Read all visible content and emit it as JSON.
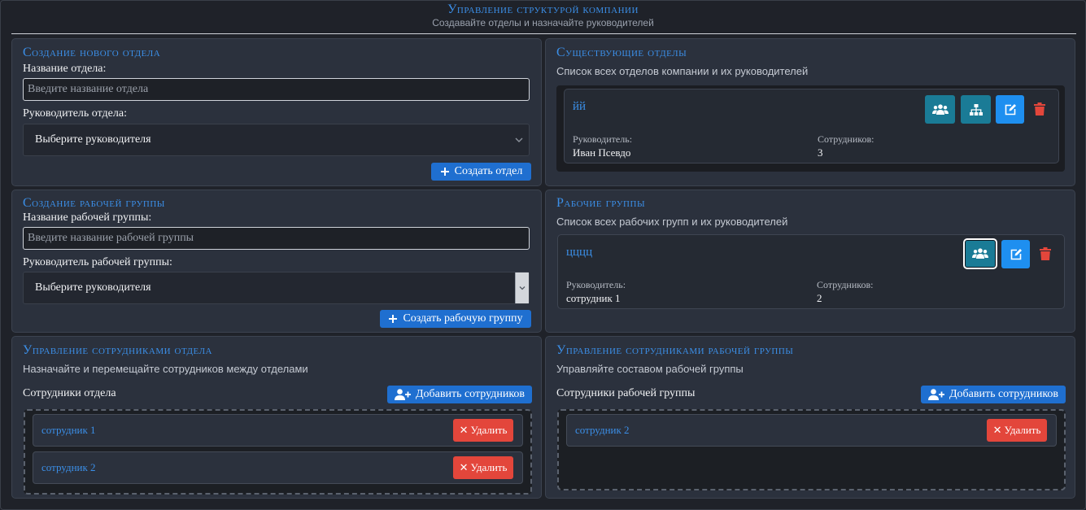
{
  "header": {
    "title": "Управление структурой компании",
    "subtitle": "Создавайте отделы и назначайте руководителей"
  },
  "create_department": {
    "title": "Создание нового отдела",
    "name_label": "Название отдела:",
    "name_placeholder": "Введите название отдела",
    "head_label": "Руководитель отдела:",
    "head_selected": "Выберите руководителя",
    "submit_label": "Создать отдел"
  },
  "create_workgroup": {
    "title": "Создание рабочей группы",
    "name_label": "Название рабочей группы:",
    "name_placeholder": "Введите название рабочей группы",
    "head_label": "Руководитель рабочей группы:",
    "head_selected": "Выберите руководителя",
    "submit_label": "Создать рабочую группу"
  },
  "departments": {
    "title": "Существующие отделы",
    "subtitle": "Список всех отделов компании и их руководителей",
    "items": [
      {
        "name": "йй",
        "head_label": "Руководитель:",
        "head_value": "Иван Псевдо",
        "count_label": "Сотрудников:",
        "count_value": "3"
      }
    ]
  },
  "workgroups": {
    "title": "Рабочие группы",
    "subtitle": "Список всех рабочих групп и их руководителей",
    "items": [
      {
        "name": "цццц",
        "head_label": "Руководитель:",
        "head_value": "сотрудник 1",
        "count_label": "Сотрудников:",
        "count_value": "2"
      }
    ]
  },
  "dept_staff": {
    "title": "Управление сотрудниками отдела",
    "subtitle": "Назначайте и перемещайте сотрудников между отделами",
    "list_label": "Сотрудники отдела",
    "add_label": "Добавить сотрудников",
    "employees": [
      {
        "name": "сотрудник 1",
        "remove_label": "Удалить"
      },
      {
        "name": "сотрудник 2",
        "remove_label": "Удалить"
      }
    ]
  },
  "group_staff": {
    "title": "Управление сотрудниками рабочей группы",
    "subtitle": "Управляйте составом рабочей группы",
    "list_label": "Сотрудники рабочей группы",
    "add_label": "Добавить сотрудников",
    "employees": [
      {
        "name": "сотрудник 2",
        "remove_label": "Удалить"
      }
    ]
  },
  "icons": {
    "users": "users-icon",
    "hierarchy": "sitemap-icon",
    "edit": "edit-icon",
    "delete": "trash-icon",
    "plus": "plus-icon",
    "add_user": "user-plus-icon",
    "remove": "x-icon",
    "select": "chevron-down-icon"
  },
  "colors": {
    "accent": "#3b8fe8",
    "primary_button": "#1f6fd0",
    "teal_button": "#1a7b96",
    "edit_button": "#1e8ff0",
    "danger": "#e3463b"
  }
}
